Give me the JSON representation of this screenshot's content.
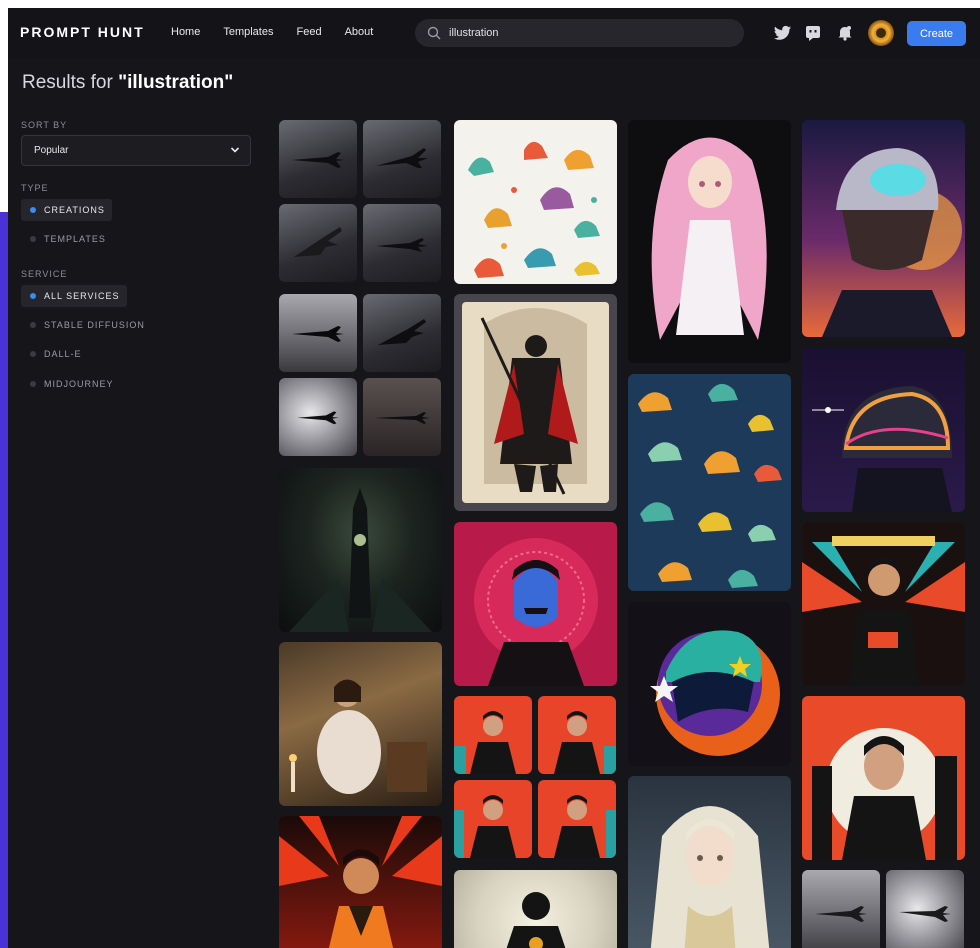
{
  "app": {
    "brand": "PROMPT HUNT"
  },
  "nav": {
    "items": [
      "Home",
      "Templates",
      "Feed",
      "About"
    ]
  },
  "search": {
    "value": "illustration"
  },
  "header_icons": [
    "twitter-icon",
    "discord-icon",
    "notification-icon",
    "profile-avatar-icon"
  ],
  "create_button": {
    "label": "Create"
  },
  "results": {
    "prefix": "Results for",
    "query": "\"illustration\""
  },
  "sidebar": {
    "sort": {
      "label": "SORT BY",
      "selected": "Popular"
    },
    "type": {
      "label": "TYPE",
      "options": [
        {
          "label": "CREATIONS",
          "selected": true
        },
        {
          "label": "TEMPLATES",
          "selected": false
        }
      ]
    },
    "service": {
      "label": "SERVICE",
      "options": [
        {
          "label": "ALL SERVICES",
          "selected": true
        },
        {
          "label": "STABLE DIFFUSION",
          "selected": false
        },
        {
          "label": "DALL-E",
          "selected": false
        },
        {
          "label": "MIDJOURNEY",
          "selected": false
        }
      ]
    }
  },
  "gallery": {
    "tiles": [
      "fighter-jet-grid",
      "fighter-jet-grid-2",
      "dark-gothic-tower",
      "candlelit-reading-woman",
      "red-poster-man",
      "colorful-dinosaurs",
      "dark-samurai-warrior",
      "red-mandala-portrait",
      "red-poster-man-grid",
      "black-shirt-man",
      "pink-hair-anime-girl",
      "dinosaur-pattern",
      "astronaut-helmet-stars",
      "white-hair-fantasy-girl",
      "helmet-rider-sunset",
      "space-helmet-planet",
      "neon-poster-man",
      "red-skyline-portrait",
      "fighter-jet-pair"
    ]
  },
  "colors": {
    "background": "#16161a",
    "accent": "#3a7bf0",
    "selected_dot": "#3a8df0",
    "side_strip": "#4a32d8"
  }
}
